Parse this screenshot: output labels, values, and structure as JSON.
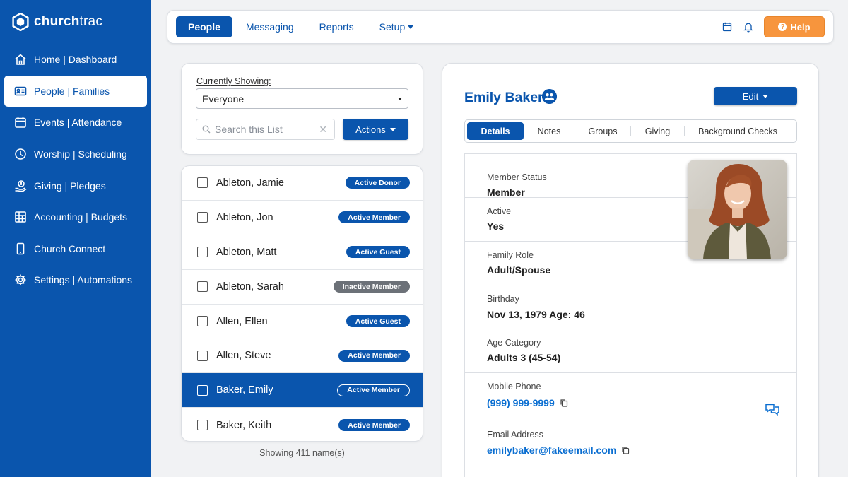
{
  "brand": {
    "name_bold": "church",
    "name_light": "trac"
  },
  "sidebar": {
    "items": [
      {
        "label": "Home | Dashboard",
        "icon": "home-icon"
      },
      {
        "label": "People | Families",
        "icon": "id-card-icon",
        "active": true
      },
      {
        "label": "Events | Attendance",
        "icon": "calendar-icon"
      },
      {
        "label": "Worship | Scheduling",
        "icon": "worship-icon"
      },
      {
        "label": "Giving | Pledges",
        "icon": "giving-icon"
      },
      {
        "label": "Accounting | Budgets",
        "icon": "ledger-icon"
      },
      {
        "label": "Church Connect",
        "icon": "phone-icon"
      },
      {
        "label": "Settings | Automations",
        "icon": "gear-icon"
      }
    ]
  },
  "topbar": {
    "tabs": [
      {
        "label": "People",
        "active": true
      },
      {
        "label": "Messaging"
      },
      {
        "label": "Reports"
      },
      {
        "label": "Setup",
        "dropdown": true
      }
    ],
    "help_label": "Help",
    "icons": [
      "calendar-icon",
      "bell-icon"
    ]
  },
  "filter": {
    "showing_label": "Currently Showing:",
    "selected": "Everyone",
    "search_placeholder": "Search this List",
    "actions_label": "Actions"
  },
  "people": [
    {
      "name": "Ableton, Jamie",
      "status": "Active Donor"
    },
    {
      "name": "Ableton, Jon",
      "status": "Active Member"
    },
    {
      "name": "Ableton, Matt",
      "status": "Active Guest"
    },
    {
      "name": "Ableton, Sarah",
      "status": "Inactive Member",
      "inactive": true
    },
    {
      "name": "Allen, Ellen",
      "status": "Active Guest"
    },
    {
      "name": "Allen, Steve",
      "status": "Active Member"
    },
    {
      "name": "Baker, Emily",
      "status": "Active Member",
      "selected": true
    },
    {
      "name": "Baker, Keith",
      "status": "Active Member"
    }
  ],
  "list_footer": "Showing 411 name(s)",
  "detail": {
    "name": "Emily Baker",
    "edit_label": "Edit",
    "tabs": [
      "Details",
      "Notes",
      "Groups",
      "Giving",
      "Background Checks"
    ],
    "fields": [
      {
        "label": "Member Status",
        "value": "Member"
      },
      {
        "label": "Active",
        "value": "Yes"
      },
      {
        "label": "Family Role",
        "value": "Adult/Spouse"
      },
      {
        "label": "Birthday",
        "value": "Nov 13, 1979 Age: 46"
      },
      {
        "label": "Age Category",
        "value": "Adults 3 (45-54)"
      },
      {
        "label": "Mobile Phone",
        "value": "(999) 999-9999"
      },
      {
        "label": "Email Address",
        "value": "emilybaker@fakeemail.com"
      }
    ]
  },
  "colors": {
    "brand_blue": "#0a55ad",
    "help_orange": "#f7953d",
    "inactive_gray": "#6c7178",
    "link_blue": "#0a6ed1"
  }
}
